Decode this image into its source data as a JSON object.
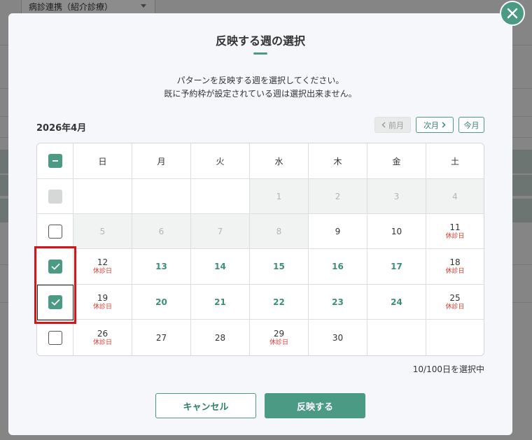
{
  "background": {
    "select_value": "病診連携（紹介診療）"
  },
  "modal": {
    "title": "反映する週の選択",
    "description_line1": "パターンを反映する週を選択してください。",
    "description_line2": "既に予約枠が設定されている週は選択出来ません。",
    "month_label": "2026年4月",
    "prev_label": "前月",
    "next_label": "次月",
    "today_label": "今月",
    "weekday_headers": [
      "日",
      "月",
      "火",
      "水",
      "木",
      "金",
      "土"
    ],
    "holiday_label": "休診日",
    "selected_count": "10/100日を選択中",
    "cancel_label": "キャンセル",
    "apply_label": "反映する",
    "weeks": [
      {
        "checkbox": "disabled",
        "days": [
          "",
          "",
          "",
          "1",
          "2",
          "3",
          "4"
        ]
      },
      {
        "checkbox": "unchecked",
        "days": [
          "5",
          "6",
          "7",
          "8",
          "9",
          "10",
          "11"
        ]
      },
      {
        "checkbox": "checked",
        "days": [
          "12",
          "13",
          "14",
          "15",
          "16",
          "17",
          "18"
        ]
      },
      {
        "checkbox": "checked",
        "days": [
          "19",
          "20",
          "21",
          "22",
          "23",
          "24",
          "25"
        ]
      },
      {
        "checkbox": "unchecked",
        "days": [
          "26",
          "27",
          "28",
          "29",
          "30",
          "",
          ""
        ]
      }
    ]
  },
  "colors": {
    "accent": "#4a9a84",
    "holiday": "#d23a2f",
    "highlight": "#d4161a"
  }
}
